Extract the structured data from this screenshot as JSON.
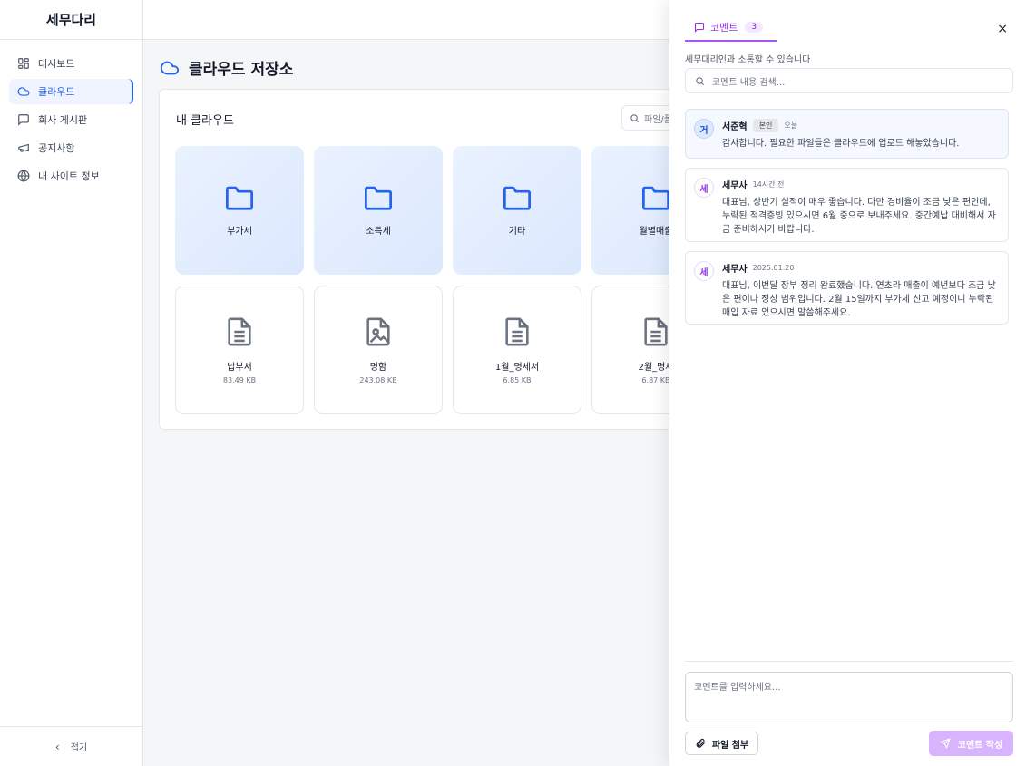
{
  "app": {
    "brand": "세무다리"
  },
  "sidebar": {
    "items": [
      {
        "label": "대시보드",
        "icon": "dashboard-icon",
        "active": false
      },
      {
        "label": "클라우드",
        "icon": "cloud-icon",
        "active": true
      },
      {
        "label": "회사 게시판",
        "icon": "message-square-icon",
        "active": false
      },
      {
        "label": "공지사항",
        "icon": "megaphone-icon",
        "active": false
      },
      {
        "label": "내 사이트 정보",
        "icon": "globe-icon",
        "active": false
      }
    ],
    "collapse_label": "접기"
  },
  "main": {
    "title": "클라우드 저장소",
    "card_title": "내 클라우드",
    "search_placeholder": "파일/폴",
    "folders": [
      {
        "name": "부가세"
      },
      {
        "name": "소득세"
      },
      {
        "name": "기타"
      },
      {
        "name": "월별매출"
      }
    ],
    "files": [
      {
        "name": "납부서",
        "size": "83.49 KB",
        "icon": "document-icon"
      },
      {
        "name": "명함",
        "size": "243.08 KB",
        "icon": "image-file-icon"
      },
      {
        "name": "1월_명세서",
        "size": "6.85 KB",
        "icon": "document-icon"
      },
      {
        "name": "2월_명세",
        "size": "6.87 KB",
        "icon": "document-icon"
      }
    ]
  },
  "comments_panel": {
    "tab_label": "코멘트",
    "count": "3",
    "close_label": "×",
    "subtitle": "세무대리인과 소통할 수 있습니다",
    "search_placeholder": "코멘트 내용 검색...",
    "comments": [
      {
        "avatar": "거",
        "author": "서준혁",
        "tag": "본인",
        "time": "오늘",
        "body": "감사합니다. 필요한 파일들은 클라우드에 업로드 해놓았습니다."
      },
      {
        "avatar": "세",
        "author": "세무사",
        "tag": "",
        "time": "14시간 전",
        "body": "대표님, 상반기 실적이 매우 좋습니다. 다만 경비율이 조금 낮은 편인데, 누락된 적격증빙 있으시면 6월 중으로 보내주세요. 중간예납 대비해서 자금 준비하시기 바랍니다."
      },
      {
        "avatar": "세",
        "author": "세무사",
        "tag": "",
        "time": "2025.01.20",
        "body": "대표님, 이번달 장부 정리 완료했습니다. 연초라 매출이 예년보다 조금 낮은 편이나 정상 범위입니다. 2월 15일까지 부가세 신고 예정이니 누락된 매입 자료 있으시면 말씀해주세요."
      }
    ],
    "input_placeholder": "코멘트를 입력하세요...",
    "attach_label": "파일 첨부",
    "submit_label": "코멘트 작성"
  },
  "colors": {
    "accent_blue": "#2563eb",
    "accent_purple": "#a855f7",
    "submit_bg": "#d8b4fe"
  }
}
